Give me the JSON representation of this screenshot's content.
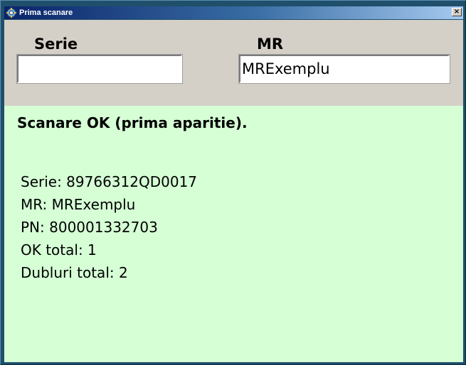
{
  "window": {
    "title": "Prima scanare",
    "close_label": "×"
  },
  "form": {
    "serie_label": "Serie",
    "serie_value": "",
    "mr_label": "MR",
    "mr_value": "MRExemplu"
  },
  "result": {
    "status": "Scanare OK (prima aparitie).",
    "lines": [
      "Serie: 89766312QD0017",
      "MR: MRExemplu",
      "PN: 800001332703",
      "OK total: 1",
      "Dubluri total: 2"
    ]
  },
  "colors": {
    "result_background": "#d6ffd6",
    "form_background": "#d4d0c8",
    "titlebar_start": "#0a246a"
  },
  "icons": {
    "app": "app-gear-icon",
    "close": "close-icon"
  }
}
